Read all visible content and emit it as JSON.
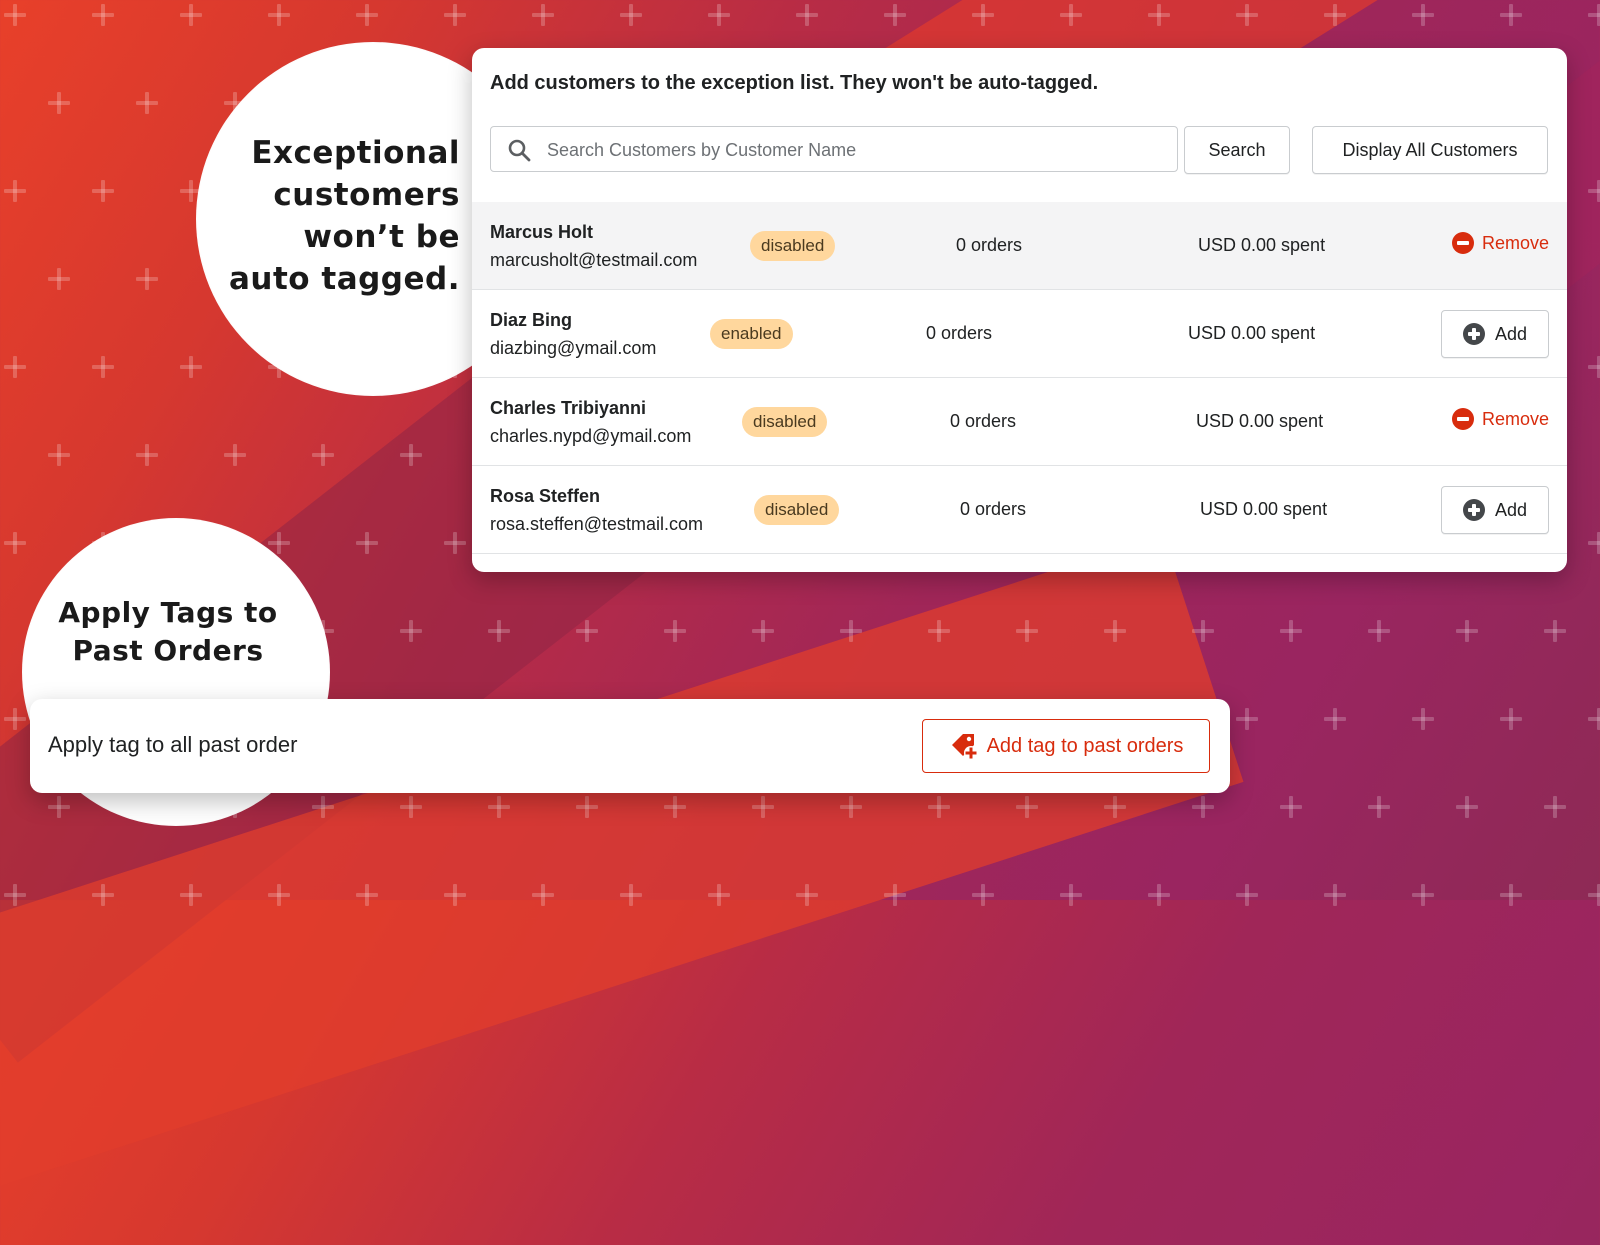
{
  "bubbles": {
    "exceptional": "Exceptional customers won’t be auto tagged.",
    "apply_tags": "Apply Tags to Past Orders"
  },
  "exception_card": {
    "title": "Add customers to the exception list. They won't be auto-tagged.",
    "search_placeholder": "Search Customers by Customer Name",
    "search_value": "",
    "search_button": "Search",
    "display_all_button": "Display All Customers",
    "customers": [
      {
        "name": "Marcus Holt",
        "email": "marcusholt@testmail.com",
        "status": "disabled",
        "orders": "0 orders",
        "spent": "USD 0.00 spent",
        "action": "Remove"
      },
      {
        "name": "Diaz Bing",
        "email": "diazbing@ymail.com",
        "status": "enabled",
        "orders": "0 orders",
        "spent": "USD 0.00 spent",
        "action": "Add"
      },
      {
        "name": "Charles Tribiyanni",
        "email": "charles.nypd@ymail.com",
        "status": "disabled",
        "orders": "0 orders",
        "spent": "USD 0.00 spent",
        "action": "Remove"
      },
      {
        "name": "Rosa Steffen",
        "email": "rosa.steffen@testmail.com",
        "status": "disabled",
        "orders": "0 orders",
        "spent": "USD 0.00 spent",
        "action": "Add"
      }
    ]
  },
  "past_orders_card": {
    "label": "Apply tag to all past order",
    "button": "Add tag to past orders"
  },
  "colors": {
    "accent_red": "#d82c0d",
    "badge_bg": "#ffd79d",
    "bg_red": "#e8402a",
    "bg_magenta": "#a02658"
  },
  "icons": {
    "search": "search-icon",
    "remove": "minus-circle-icon",
    "add": "plus-circle-icon",
    "tag": "tag-plus-icon"
  }
}
